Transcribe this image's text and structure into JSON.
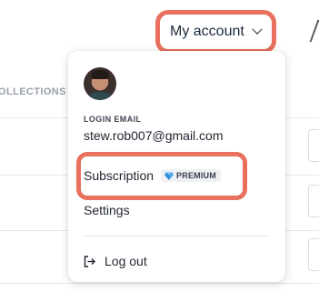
{
  "background": {
    "collections_label": "OLLECTIONS"
  },
  "account_button": {
    "label": "My account",
    "icon": "chevron-down-icon"
  },
  "dropdown": {
    "avatar_icon": "user-avatar",
    "login_email_label": "LOGIN EMAIL",
    "login_email_value": "stew.rob007@gmail.com",
    "subscription_label": "Subscription",
    "premium_badge": "PREMIUM",
    "premium_icon": "diamond-icon",
    "settings_label": "Settings",
    "logout_label": "Log out",
    "logout_icon": "logout-icon"
  },
  "colors": {
    "highlight": "#e8705e",
    "badge_bg": "#eef0f3",
    "gem": "#4aa3e8"
  }
}
